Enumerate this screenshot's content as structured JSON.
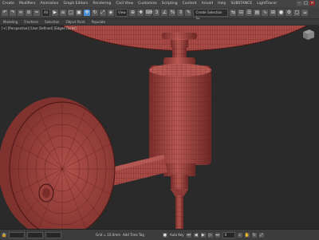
{
  "menubar": {
    "items": [
      "Create",
      "Modifiers",
      "Animation",
      "Graph Editors",
      "Rendering",
      "Civil View",
      "Customize",
      "Scripting",
      "Content",
      "Arnold",
      "Help",
      "SUBSTANCE",
      "LightTracer"
    ],
    "window_buttons": [
      "–",
      "□",
      "×"
    ]
  },
  "toolbar": {
    "selection_filter": "All",
    "view_dropdown": "View",
    "named_selection": "Create Selection Se"
  },
  "ribbon": {
    "tabs": [
      "Modeling",
      "Freeform",
      "Selection",
      "Object Paint",
      "Populate"
    ]
  },
  "viewport": {
    "label": "[+] [Perspective] [User Defined] [Edged Faces]"
  },
  "status": {
    "grid_text": "Grid = 10.0mm",
    "add_time_tag": "Add Time Tag",
    "frame_field": "0",
    "key_mode": "Auto Key"
  },
  "colors": {
    "model": "#a84a45",
    "wire": "#5b1c1a",
    "accent": "#4a90d9"
  }
}
